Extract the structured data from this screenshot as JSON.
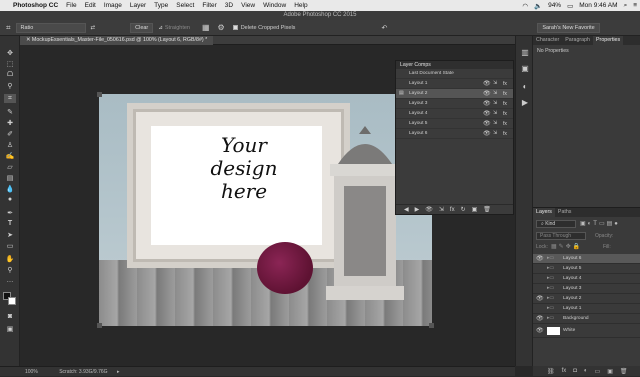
{
  "menubar": {
    "apple": "",
    "app": "Photoshop CC",
    "items": [
      "File",
      "Edit",
      "Image",
      "Layer",
      "Type",
      "Select",
      "Filter",
      "3D",
      "View",
      "Window",
      "Help"
    ],
    "battery": "94%",
    "clock": "Mon 9:46 AM"
  },
  "titlebar": {
    "title": "Adobe Photoshop CC 2015"
  },
  "options": {
    "ratio": "Ratio",
    "clear": "Clear",
    "straighten": "Straighten",
    "delete_cropped": "Delete Cropped Pixels",
    "workspace": "Sarah's New Favorite"
  },
  "document": {
    "tab_label": "MockupEssentials_Master-File_050616.psd @ 100% (Layout 6, RGB/8#) *",
    "art_text": "Your design here"
  },
  "layer_comps": {
    "title": "Layer Comps",
    "rows": [
      {
        "label": "Last Document State"
      },
      {
        "label": "Layout 1"
      },
      {
        "label": "Layout 2"
      },
      {
        "label": "Layout 3"
      },
      {
        "label": "Layout 4"
      },
      {
        "label": "Layout 5"
      },
      {
        "label": "Layout 6"
      }
    ],
    "selected_index": 2
  },
  "right_panel": {
    "tabs": [
      "Character",
      "Paragraph",
      "Properties"
    ],
    "active_tab": "Properties",
    "body": "No Properties"
  },
  "layers_panel": {
    "tabs": [
      "Layers",
      "Paths"
    ],
    "kind": "Kind",
    "blend_mode": "Pass Through",
    "opacity_label": "Opacity:",
    "lock_label": "Lock:",
    "fill_label": "Fill:",
    "rows": [
      {
        "label": "Layout 6",
        "selected": true
      },
      {
        "label": "Layout 5",
        "selected": false
      },
      {
        "label": "Layout 4",
        "selected": false
      },
      {
        "label": "Layout 3",
        "selected": false
      },
      {
        "label": "Layout 2",
        "selected": false
      },
      {
        "label": "Layout 1",
        "selected": false
      },
      {
        "label": "Background",
        "selected": false
      },
      {
        "label": "White",
        "selected": false
      }
    ]
  },
  "status": {
    "zoom": "100%",
    "scratch": "Scratch: 3.93G/9.76G"
  }
}
